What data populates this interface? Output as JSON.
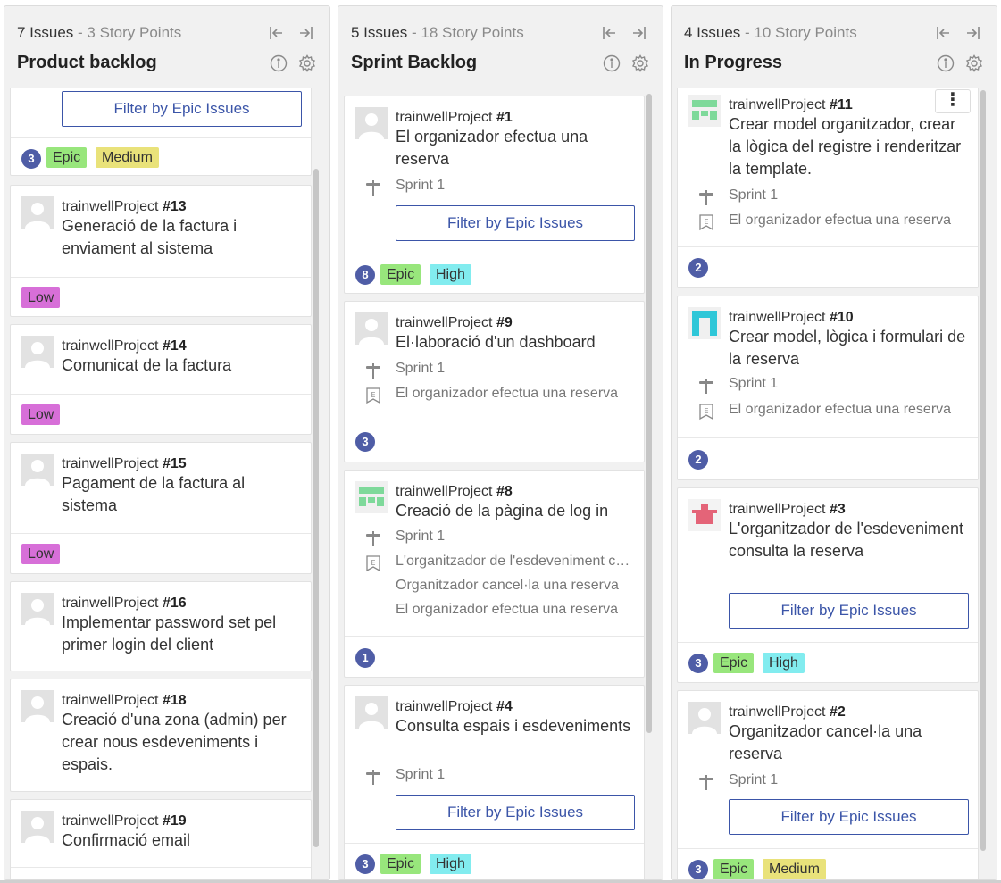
{
  "board": {
    "columns": [
      {
        "issues": "7 Issues",
        "story_points": " - 3 Story Points",
        "title": "Product backlog"
      },
      {
        "issues": "5 Issues",
        "story_points": " - 18 Story Points",
        "title": "Sprint Backlog"
      },
      {
        "issues": "4 Issues",
        "story_points": " - 10 Story Points",
        "title": "In Progress"
      }
    ],
    "filter_label": "Filter by Epic Issues",
    "more_label": "⋮"
  },
  "product_backlog": {
    "top_card": {
      "points": "3",
      "tags": [
        "Epic",
        "Medium"
      ]
    },
    "cards": [
      {
        "project": "trainwellProject ",
        "number": "#13",
        "summary": "Generació de la factura i enviament al sistema",
        "tag": "Low"
      },
      {
        "project": "trainwellProject ",
        "number": "#14",
        "summary": "Comunicat de la factura",
        "tag": "Low"
      },
      {
        "project": "trainwellProject ",
        "number": "#15",
        "summary": "Pagament de la factura al sistema",
        "tag": "Low"
      },
      {
        "project": "trainwellProject ",
        "number": "#16",
        "summary": "Implementar password set pel primer login del client"
      },
      {
        "project": "trainwellProject ",
        "number": "#18",
        "summary": "Creació d'una zona (admin) per crear nous esdeveniments i espais."
      },
      {
        "project": "trainwellProject ",
        "number": "#19",
        "summary": "Confirmació email"
      }
    ]
  },
  "sprint_backlog": {
    "cards": [
      {
        "project": "trainwellProject ",
        "number": "#1",
        "summary": "El organizador efectua una reserva",
        "sprint": "Sprint 1",
        "points": "8",
        "tags": [
          "Epic",
          "High"
        ]
      },
      {
        "project": "trainwellProject ",
        "number": "#9",
        "summary": "El·laboració d'un dashboard",
        "sprint": "Sprint 1",
        "epic": "El organizador efectua una reserva",
        "points": "3"
      },
      {
        "project": "trainwellProject ",
        "number": "#8",
        "summary": "Creació de la pàgina de log in",
        "sprint": "Sprint 1",
        "epics": [
          "L'organitzador de l'esdeveniment consulta la reserva",
          "Organitzador cancel·la una reserva",
          "El organizador efectua una reserva"
        ],
        "points": "1"
      },
      {
        "project": "trainwellProject ",
        "number": "#4",
        "summary": "Consulta espais i esdeveniments",
        "sprint": "Sprint 1",
        "points": "3",
        "tags": [
          "Epic",
          "High"
        ]
      }
    ]
  },
  "in_progress": {
    "cards": [
      {
        "project": "trainwellProject ",
        "number": "#11",
        "summary": "Crear model organitzador, crear la lògica del registre i renderitzar la template.",
        "sprint": "Sprint 1",
        "epic": "El organizador efectua una reserva",
        "points": "2"
      },
      {
        "project": "trainwellProject ",
        "number": "#10",
        "summary": "Crear model, lògica i formulari de la reserva",
        "sprint": "Sprint 1",
        "epic": "El organizador efectua una reserva",
        "points": "2"
      },
      {
        "project": "trainwellProject ",
        "number": "#3",
        "summary": "L'organitzador de l'esdeveniment consulta la reserva",
        "points": "3",
        "tags": [
          "Epic",
          "High"
        ]
      },
      {
        "project": "trainwellProject ",
        "number": "#2",
        "summary": "Organitzador cancel·la una reserva",
        "sprint": "Sprint 1",
        "points": "3",
        "tags": [
          "Epic",
          "Medium"
        ]
      }
    ]
  },
  "colors": {
    "epic": "#98e67c",
    "medium": "#e9e27a",
    "high": "#82ecef",
    "low": "#d76fd8",
    "points_badge": "#4f5da6",
    "link": "#3b55a8"
  },
  "icons": [
    "collapse-left-icon",
    "collapse-right-icon",
    "info-icon",
    "settings-icon",
    "sprint-icon",
    "epic-icon"
  ]
}
